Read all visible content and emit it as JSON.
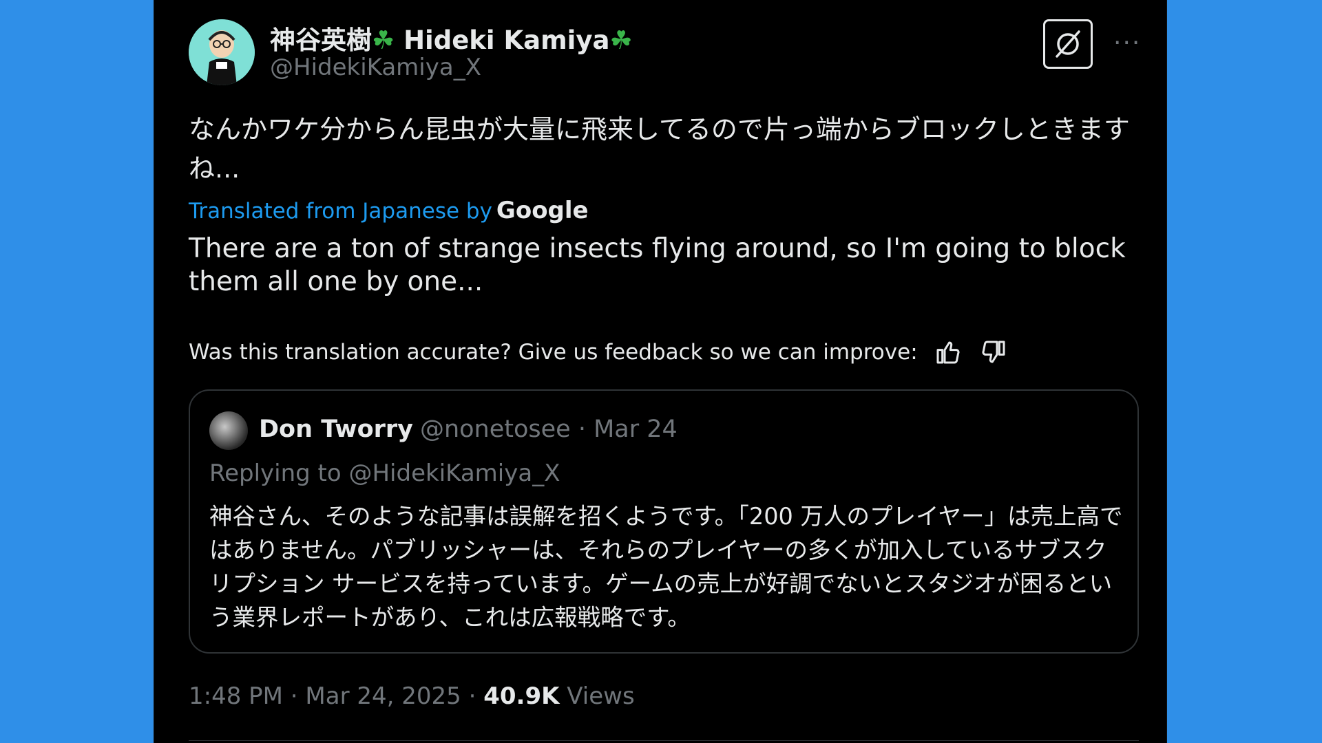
{
  "tweet": {
    "author": {
      "name": "神谷英樹",
      "name_latin": "Hideki Kamiya",
      "clover": "☘",
      "handle": "@HidekiKamiya_X"
    },
    "text_jp": "なんかワケ分からん昆虫が大量に飛来してるので片っ端からブロックしときますね...",
    "translation": {
      "label": "Translated from Japanese by",
      "provider": "Google",
      "text": "There are a ton of strange insects flying around, so I'm going to block them all one by one..."
    },
    "feedback": {
      "prompt": "Was this translation accurate? Give us feedback so we can improve:"
    },
    "quote": {
      "name": "Don Tworry",
      "meta": "@nonetosee · Mar 24",
      "replying_to": "Replying to @HidekiKamiya_X",
      "text": "神谷さん、そのような記事は誤解を招くようです。「200 万人のプレイヤー」は売上高ではありません。パブリッシャーは、それらのプレイヤーの多くが加入しているサブスクリプション サービスを持っています。ゲームの売上が好調でないとスタジオが困るという業界レポートがあり、これは広報戦略です。"
    },
    "footer": {
      "time": "1:48 PM · Mar 24, 2025 · ",
      "views_count": "40.9K",
      "views_label": " Views"
    }
  },
  "colors": {
    "background": "#2f8fe8",
    "card": "#000000",
    "link": "#1d9bf0",
    "muted": "#71767b",
    "text": "#e7e9ea",
    "clover": "#3ab54a"
  },
  "icons": {
    "grok": "grok-icon",
    "more": "more-icon",
    "thumbs_up": "thumbs-up-icon",
    "thumbs_down": "thumbs-down-icon"
  }
}
